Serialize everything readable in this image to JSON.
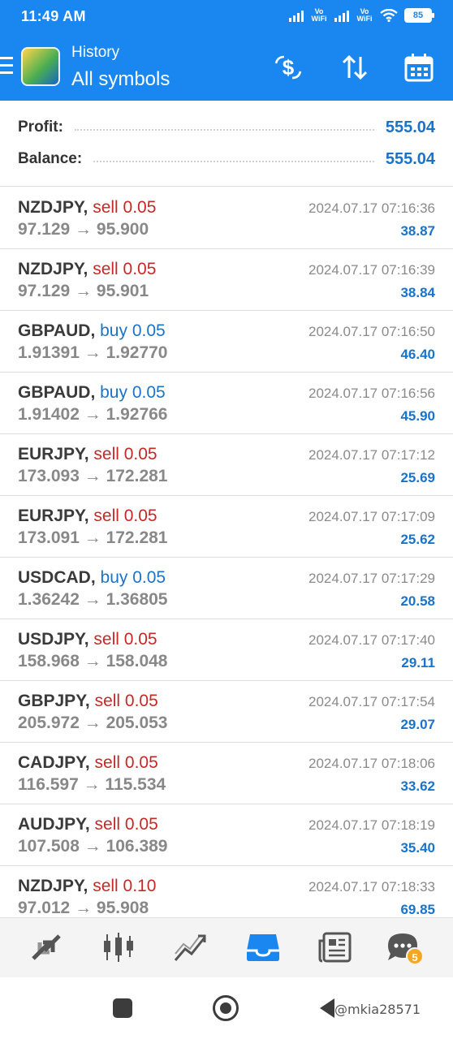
{
  "status_bar": {
    "time": "11:49 AM",
    "network_label_1": "Vo WiFi",
    "network_label_2": "Vo WiFi",
    "battery": "85"
  },
  "header": {
    "subtitle": "History",
    "title": "All symbols",
    "icons": [
      "menu-icon",
      "app-logo",
      "deposit-icon",
      "sort-icon",
      "calendar-icon"
    ]
  },
  "summary": {
    "profit_label": "Profit:",
    "profit_value": "555.04",
    "balance_label": "Balance:",
    "balance_value": "555.04"
  },
  "trades": [
    {
      "symbol": "NZDJPY,",
      "side": "sell 0.05",
      "prices": "97.129 → 95.900",
      "date": "2024.07.17 07:16:36",
      "profit": "38.87"
    },
    {
      "symbol": "NZDJPY,",
      "side": "sell 0.05",
      "prices": "97.129 → 95.901",
      "date": "2024.07.17 07:16:39",
      "profit": "38.84"
    },
    {
      "symbol": "GBPAUD,",
      "side": "buy 0.05",
      "prices": "1.91391 → 1.92770",
      "date": "2024.07.17 07:16:50",
      "profit": "46.40"
    },
    {
      "symbol": "GBPAUD,",
      "side": "buy 0.05",
      "prices": "1.91402 → 1.92766",
      "date": "2024.07.17 07:16:56",
      "profit": "45.90"
    },
    {
      "symbol": "EURJPY,",
      "side": "sell 0.05",
      "prices": "173.093 → 172.281",
      "date": "2024.07.17 07:17:12",
      "profit": "25.69"
    },
    {
      "symbol": "EURJPY,",
      "side": "sell 0.05",
      "prices": "173.091 → 172.281",
      "date": "2024.07.17 07:17:09",
      "profit": "25.62"
    },
    {
      "symbol": "USDCAD,",
      "side": "buy 0.05",
      "prices": "1.36242 → 1.36805",
      "date": "2024.07.17 07:17:29",
      "profit": "20.58"
    },
    {
      "symbol": "USDJPY,",
      "side": "sell 0.05",
      "prices": "158.968 → 158.048",
      "date": "2024.07.17 07:17:40",
      "profit": "29.11"
    },
    {
      "symbol": "GBPJPY,",
      "side": "sell 0.05",
      "prices": "205.972 → 205.053",
      "date": "2024.07.17 07:17:54",
      "profit": "29.07"
    },
    {
      "symbol": "CADJPY,",
      "side": "sell 0.05",
      "prices": "116.597 → 115.534",
      "date": "2024.07.17 07:18:06",
      "profit": "33.62"
    },
    {
      "symbol": "AUDJPY,",
      "side": "sell 0.05",
      "prices": "107.508 → 106.389",
      "date": "2024.07.17 07:18:19",
      "profit": "35.40"
    },
    {
      "symbol": "NZDJPY,",
      "side": "sell 0.10",
      "prices": "97.012 → 95.908",
      "date": "2024.07.17 07:18:33",
      "profit": "69.85"
    }
  ],
  "bottom_nav": {
    "items": [
      "quotes-icon",
      "chart-icon",
      "trade-icon",
      "history-icon",
      "news-icon",
      "chat-icon"
    ],
    "active": "history-icon",
    "chat_badge": "5"
  },
  "watermark": "@mkia28571",
  "colors": {
    "header_blue": "#1a86f0",
    "sell_red": "#c62828",
    "buy_blue": "#1a73c8",
    "profit_blue": "#1a73c8"
  }
}
